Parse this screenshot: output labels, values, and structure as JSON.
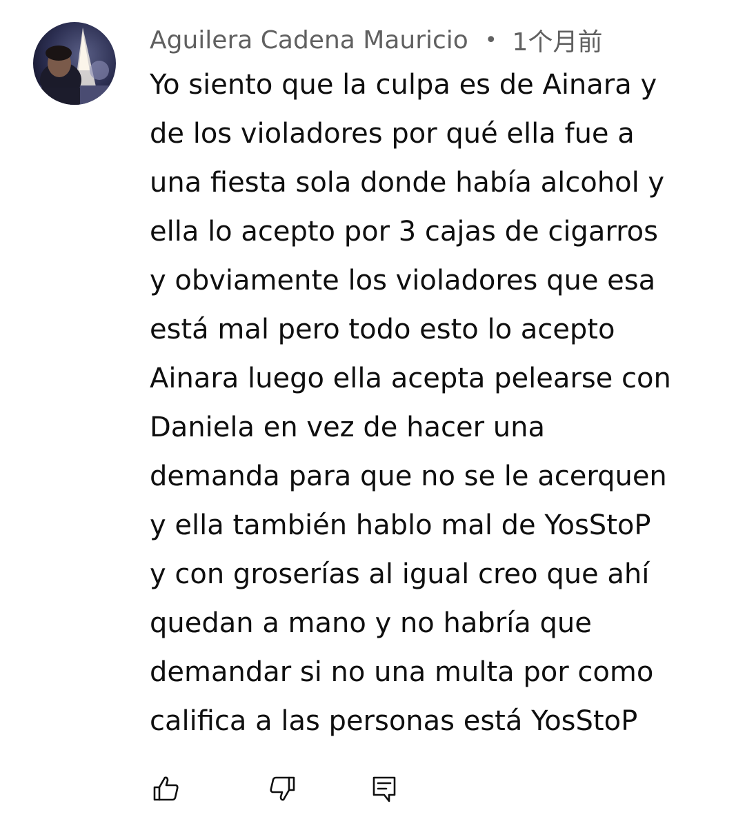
{
  "comment": {
    "author": "Aguilera Cadena Mauricio",
    "separator": "•",
    "timestamp": "1个月前",
    "text": "Yo siento que la culpa es de Ainara y\nde los violadores por qué ella fue a\nuna fiesta sola donde había alcohol y\nella lo acepto por 3 cajas de cigarros\ny obviamente los violadores que esa\nestá mal pero todo esto lo acepto\nAinara luego ella acepta pelearse con\nDaniela en vez de hacer una\ndemanda para que no se le acerquen\ny ella también hablo mal de YosStoP\ny con groserías al igual creo que ahí\nquedan a mano y no habría que\ndemandar si no una multa por como\ncalifica a las personas está YosStoP"
  },
  "actions": {
    "like_icon": "thumbs-up-icon",
    "dislike_icon": "thumbs-down-icon",
    "reply_icon": "reply-comment-icon"
  }
}
